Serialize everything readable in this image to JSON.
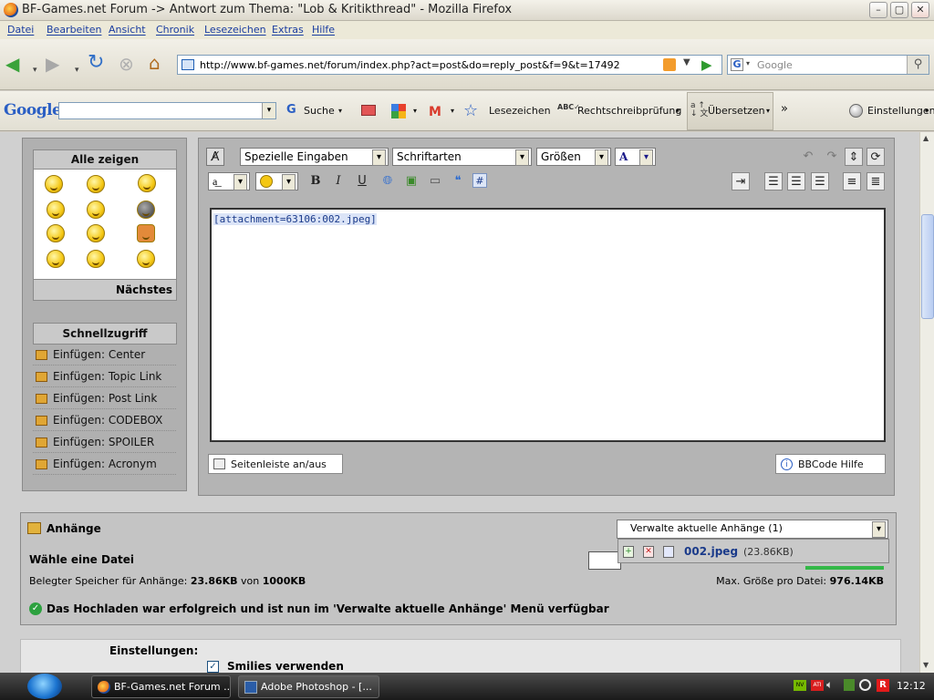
{
  "window": {
    "title": "BF-Games.net Forum -> Antwort zum Thema: \"Lob & Kritikthread\" - Mozilla Firefox",
    "min": "–",
    "max": "▢",
    "close": "✕"
  },
  "menu": [
    "Datei",
    "Bearbeiten",
    "Ansicht",
    "Chronik",
    "Lesezeichen",
    "Extras",
    "Hilfe"
  ],
  "nav": {
    "url": "http://www.bf-games.net/forum/index.php?act=post&do=reply_post&f=9&t=17492",
    "search_placeholder": "Google"
  },
  "google_toolbar": {
    "logo": "Google",
    "search_label": "Suche",
    "bookmarks_label": "Lesezeichen",
    "spellcheck_label": "Rechtschreibprüfung",
    "translate_label": "Übersetzen",
    "more_label": "»",
    "settings_label": "Einstellungen"
  },
  "sidebar": {
    "emoticons_title": "Alle zeigen",
    "next_label": "Nächstes",
    "quick_title": "Schnellzugriff",
    "quick_items": [
      "Einfügen: Center",
      "Einfügen: Topic Link",
      "Einfügen: Post Link",
      "Einfügen: CODEBOX",
      "Einfügen: SPOILER",
      "Einfügen: Acronym"
    ]
  },
  "editor": {
    "special_select": "Spezielle Eingaben",
    "font_select": "Schriftarten",
    "size_select": "Größen",
    "color_label": "A",
    "content": "[attachment=63106:002.jpeg]",
    "sidebar_toggle": "Seitenleiste an/aus",
    "bbcode_help": "BBCode Hilfe"
  },
  "attachments": {
    "title": "Anhänge",
    "choose_file": "Wähle eine Datei",
    "storage_label": "Belegter Speicher für Anhänge:",
    "storage_used": "23.86KB",
    "storage_of": "von",
    "storage_total": "1000KB",
    "manage_select": "Verwalte aktuelle Anhänge (1)",
    "file_name": "002.jpeg",
    "file_size": "(23.86KB)",
    "max_label": "Max. Größe pro Datei:",
    "max_value": "976.14KB",
    "success_msg": "Das Hochladen war erfolgreich und ist nun im 'Verwalte aktuelle Anhänge' Menü verfügbar"
  },
  "settings": {
    "title": "Einstellungen:",
    "smilies_label": "Smilies verwenden"
  },
  "taskbar": {
    "tasks": [
      "BF-Games.net Forum ...",
      "Adobe Photoshop - [..."
    ],
    "clock": "12:12"
  }
}
